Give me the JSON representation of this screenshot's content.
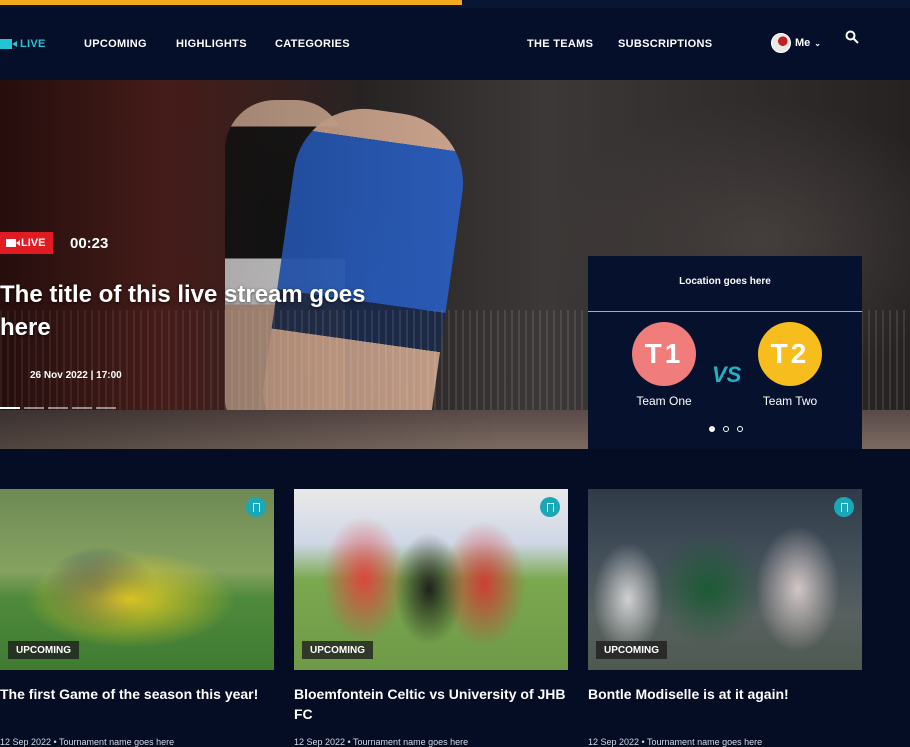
{
  "colors": {
    "accent": "#f2a91d",
    "live_red": "#e11b22",
    "teal": "#1fb3c4",
    "team_one": "#f07c7c",
    "team_two": "#f6bd1d",
    "background": "#040d24"
  },
  "nav": {
    "live": "LIVE",
    "upcoming": "UPCOMING",
    "highlights": "HIGHLIGHTS",
    "categories": "CATEGORIES",
    "the_teams": "THE TEAMS",
    "subscriptions": "SUBSCRIPTIONS",
    "me": "Me",
    "chevron": "⌄",
    "icons": [
      "video-camera-icon",
      "avatar",
      "chevron-down-icon",
      "search-icon"
    ]
  },
  "hero": {
    "live_badge": "LIVE",
    "timer": "00:23",
    "title": "The title of this live stream goes here",
    "date": "26 Nov 2022 | 17:00",
    "slides": 5,
    "active_slide": 1
  },
  "match": {
    "location": "Location goes here",
    "team_one": {
      "short": "T1",
      "name": "Team One"
    },
    "vs": "VS",
    "team_two": {
      "short": "T2",
      "name": "Team Two"
    },
    "pages": 3,
    "active_page": 1
  },
  "cards": [
    {
      "tag": "UPCOMING",
      "title": "The first Game of the season this year!",
      "meta": "12 Sep 2022  •  Tournament name goes here"
    },
    {
      "tag": "UPCOMING",
      "title": "Bloemfontein Celtic vs University of JHB FC",
      "meta": "12 Sep 2022  •  Tournament name goes here"
    },
    {
      "tag": "UPCOMING",
      "title": "Bontle Modiselle is at it again!",
      "meta": "12 Sep 2022  •  Tournament name goes here"
    }
  ]
}
